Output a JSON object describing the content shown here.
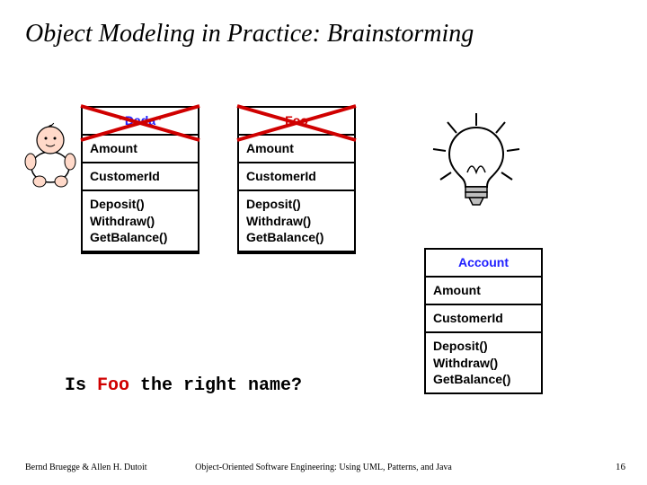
{
  "title": "Object Modeling in Practice:  Brainstorming",
  "boxes": {
    "dada": {
      "name_prefix": "“",
      "name_core": "Dada",
      "name_suffix": "”",
      "attr1": "Amount",
      "attr2": "CustomerId",
      "ops": "Deposit()\nWithdraw()\nGetBalance()"
    },
    "foo": {
      "name": "Foo",
      "attr1": "Amount",
      "attr2": "CustomerId",
      "ops": "Deposit()\nWithdraw()\nGetBalance()"
    },
    "account": {
      "name": "Account",
      "attr1": "Amount",
      "attr2": "CustomerId",
      "ops": "Deposit()\nWithdraw()\nGetBalance()"
    }
  },
  "question": {
    "pre": "Is ",
    "mid": "Foo",
    "post": " the right name?"
  },
  "footer": {
    "left": "Bernd Bruegge & Allen H. Dutoit",
    "center": "Object-Oriented Software Engineering: Using UML, Patterns, and Java",
    "right": "16"
  },
  "colors": {
    "blue": "#2020ff",
    "red": "#d00000"
  }
}
